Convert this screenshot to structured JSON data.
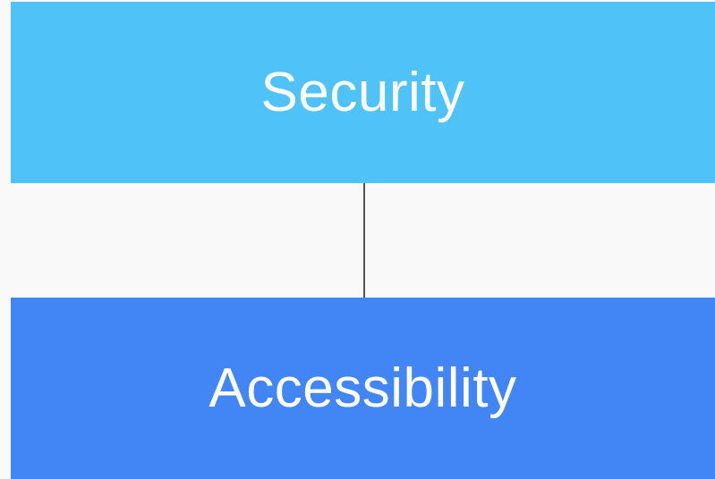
{
  "diagram": {
    "nodes": [
      {
        "id": "security",
        "label": "Security",
        "color": "#4fc3f7"
      },
      {
        "id": "accessibility",
        "label": "Accessibility",
        "color": "#4285f4"
      }
    ],
    "edges": [
      {
        "from": "security",
        "to": "accessibility"
      }
    ],
    "connector_color": "#555555",
    "background": "#f9f9f9"
  }
}
